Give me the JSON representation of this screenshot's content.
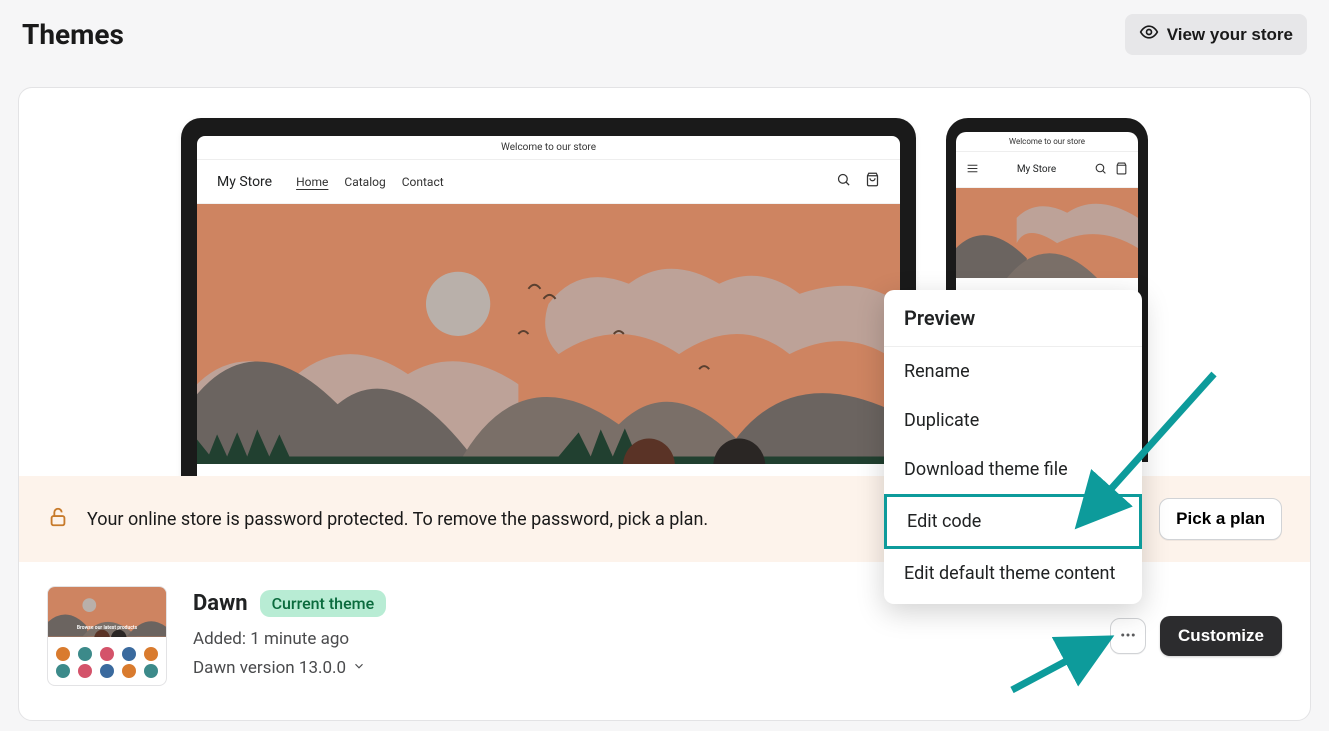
{
  "header": {
    "title": "Themes",
    "view_store": "View your store"
  },
  "store_preview": {
    "announcement": "Welcome to our store",
    "store_name": "My Store",
    "nav": {
      "home": "Home",
      "catalog": "Catalog",
      "contact": "Contact"
    }
  },
  "banner": {
    "message": "Your online store is password protected. To remove the password, pick a plan.",
    "pick_plan": "Pick a plan"
  },
  "theme": {
    "name": "Dawn",
    "badge": "Current theme",
    "added": "Added: 1 minute ago",
    "version": "Dawn version 13.0.0",
    "thumb_caption": "Browse our latest products"
  },
  "actions": {
    "customize": "Customize"
  },
  "dropdown": {
    "header": "Preview",
    "items": {
      "rename": "Rename",
      "duplicate": "Duplicate",
      "download": "Download theme file",
      "edit_code": "Edit code",
      "edit_default": "Edit default theme content"
    }
  }
}
